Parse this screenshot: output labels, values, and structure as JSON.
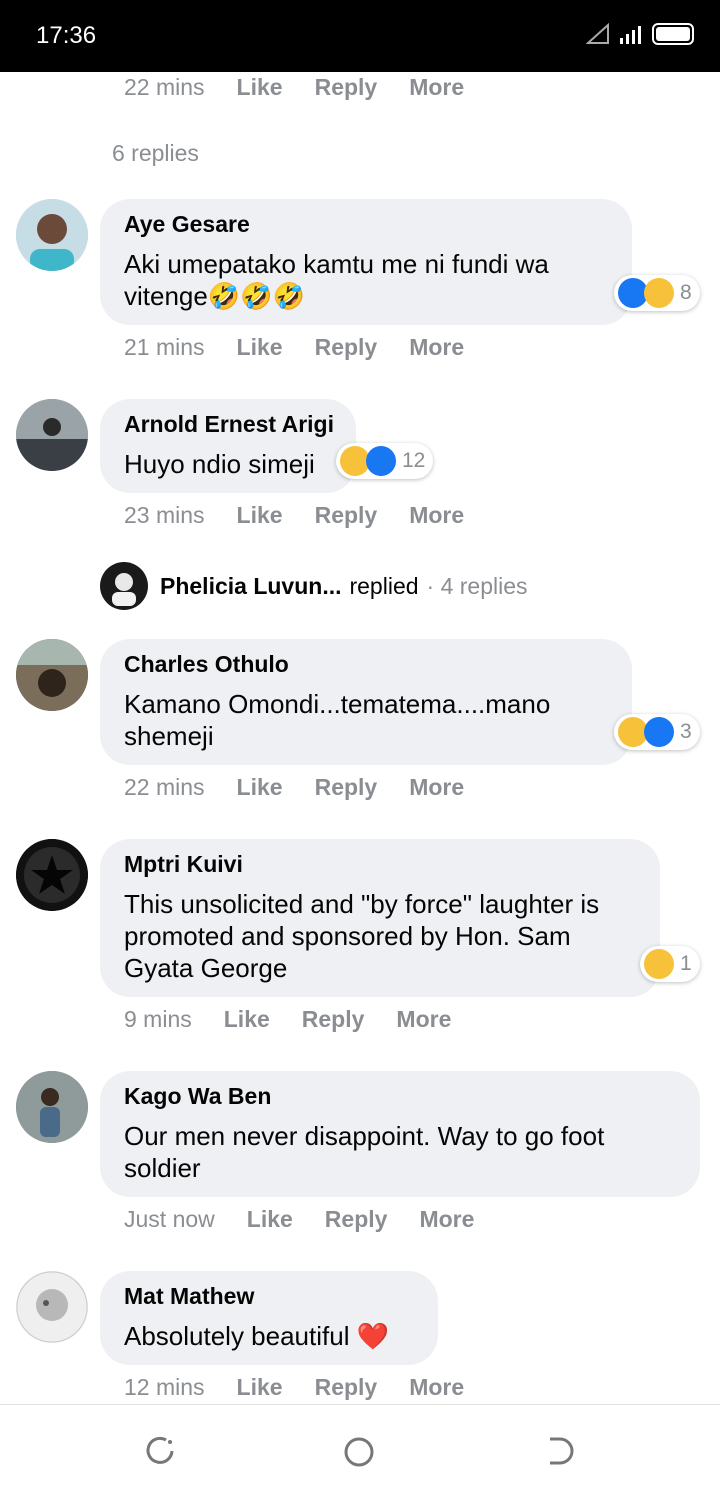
{
  "status_bar": {
    "time": "17:36"
  },
  "top_meta": {
    "time": "22 mins",
    "like": "Like",
    "reply": "Reply",
    "more": "More"
  },
  "replies_link": "6 replies",
  "comments": [
    {
      "name": "Aye Gesare",
      "text": "Aki umepatako kamtu me ni fundi wa vitenge🤣🤣🤣",
      "time": "21 mins",
      "reaction_count": "8"
    },
    {
      "name": "Arnold Ernest Arigi",
      "text": "Huyo ndio simeji",
      "time": "23 mins",
      "reaction_count": "12"
    },
    {
      "name": "Charles Othulo",
      "text": "Kamano Omondi...tematema....mano shemeji",
      "time": "22 mins",
      "reaction_count": "3"
    },
    {
      "name": "Mptri Kuivi",
      "text": "This unsolicited and \"by force\" laughter is promoted and sponsored by Hon. Sam Gyata George",
      "time": "9 mins",
      "reaction_count": "1"
    },
    {
      "name": "Kago Wa Ben",
      "text": "Our men never disappoint. Way to go foot soldier",
      "time": "Just now"
    },
    {
      "name": "Mat Mathew",
      "text": "Absolutely beautiful ❤️",
      "time": "12 mins"
    }
  ],
  "thread": {
    "name": "Phelicia Luvun...",
    "replied": "replied",
    "replies": "· 4 replies"
  },
  "actions": {
    "like": "Like",
    "reply": "Reply",
    "more": "More"
  }
}
